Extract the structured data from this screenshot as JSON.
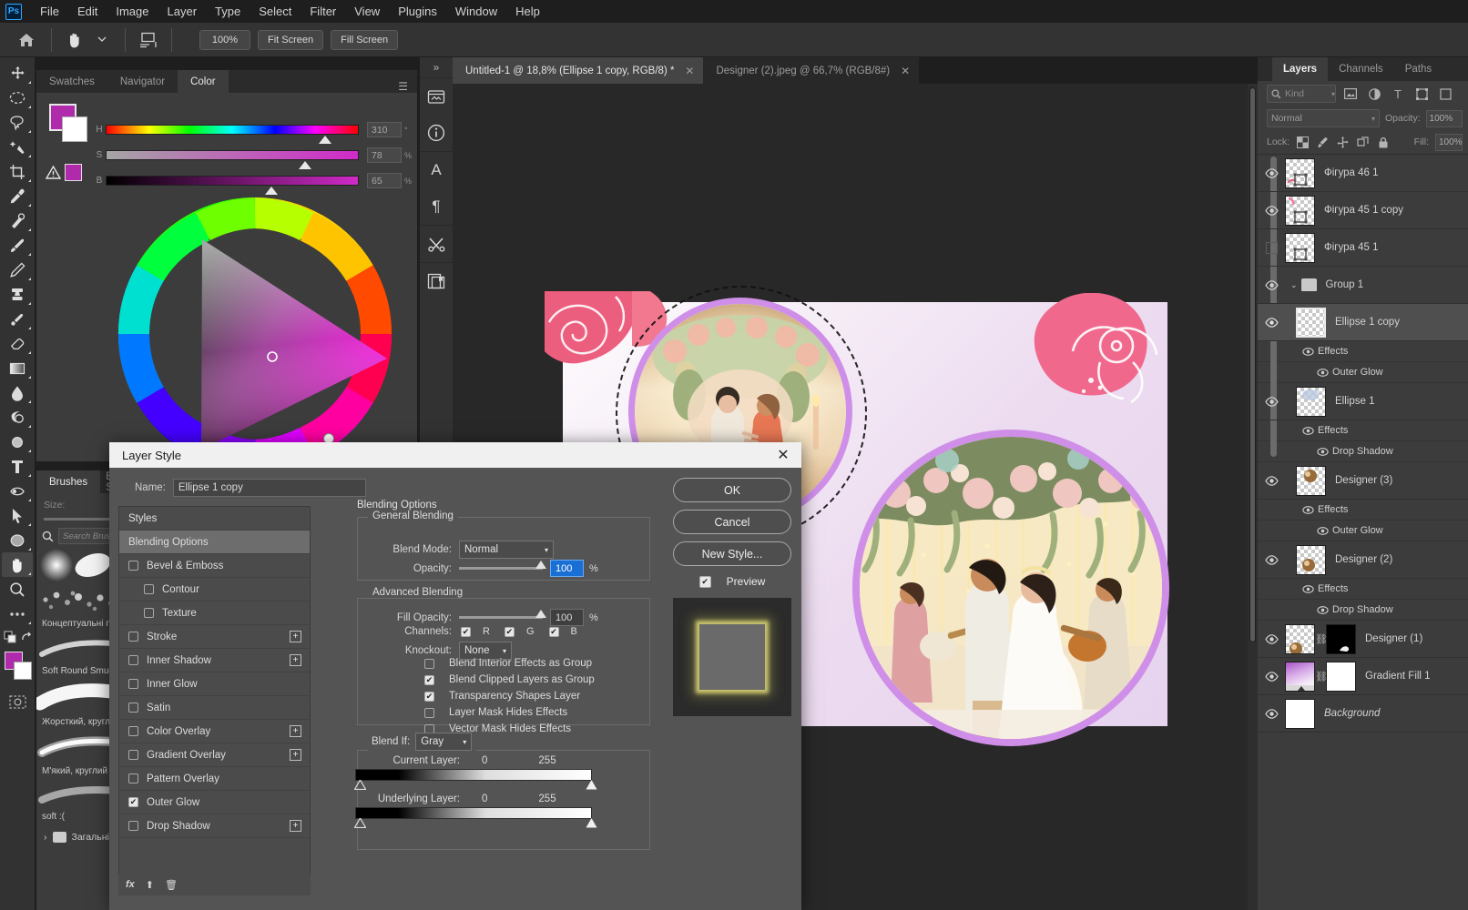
{
  "app": {
    "logo": "Ps"
  },
  "menubar": {
    "items": [
      "File",
      "Edit",
      "Image",
      "Layer",
      "Type",
      "Select",
      "Filter",
      "View",
      "Plugins",
      "Window",
      "Help"
    ]
  },
  "optionsbar": {
    "zoom_value": "100%",
    "fit_screen": "Fit Screen",
    "fill_screen": "Fill Screen",
    "home_icon": "home-icon",
    "hand_icon": "hand-tool-icon",
    "arrange_icon": "arrange-documents-icon"
  },
  "toolbar": {
    "tools": [
      {
        "name": "move-tool",
        "glyph": "✥"
      },
      {
        "name": "elliptical-marquee-tool",
        "glyph": "◯"
      },
      {
        "name": "lasso-tool",
        "glyph": "⌁"
      },
      {
        "name": "object-selection-tool",
        "glyph": "✨"
      },
      {
        "name": "crop-tool",
        "glyph": "⌗"
      },
      {
        "name": "eyedropper-tool",
        "glyph": "⟋"
      },
      {
        "name": "spot-healing-brush-tool",
        "glyph": "⦆"
      },
      {
        "name": "brush-tool",
        "glyph": "✎"
      },
      {
        "name": "clone-stamp-tool",
        "glyph": "⎈"
      },
      {
        "name": "history-brush-tool",
        "glyph": "↺"
      },
      {
        "name": "eraser-tool",
        "glyph": "▱"
      },
      {
        "name": "gradient-tool",
        "glyph": "▤"
      },
      {
        "name": "blur-tool",
        "glyph": "💧"
      },
      {
        "name": "dodge-tool",
        "glyph": "◗"
      },
      {
        "name": "pen-tool",
        "glyph": "✒"
      },
      {
        "name": "type-tool",
        "glyph": "T"
      },
      {
        "name": "path-selection-tool",
        "glyph": "➤"
      },
      {
        "name": "direct-selection-tool",
        "glyph": "➤"
      },
      {
        "name": "ellipse-tool",
        "glyph": "⬭"
      },
      {
        "name": "hand-tool",
        "glyph": "✋",
        "selected": true
      },
      {
        "name": "zoom-tool",
        "glyph": "🔍"
      },
      {
        "name": "edit-toolbar-tool",
        "glyph": "•••"
      }
    ],
    "quick_mask_icon": "quick-mask-icon",
    "screen_mode_icon": "screen-mode-icon"
  },
  "color_panel": {
    "tabs": [
      "Swatches",
      "Navigator",
      "Color"
    ],
    "active_tab": "Color",
    "menu_icon": "panel-menu-icon",
    "foreground_color": "#b02bab",
    "background_color": "#ffffff",
    "sliders": [
      {
        "label": "H",
        "value": "310",
        "unit": "°",
        "pos": 0.861
      },
      {
        "label": "S",
        "value": "78",
        "unit": "%",
        "pos": 0.783
      },
      {
        "label": "B",
        "value": "65",
        "unit": "%",
        "pos": 0.652
      }
    ],
    "warning_icon": "out-of-gamut-warning-icon"
  },
  "middle_dock": {
    "collapse_icon": "collapse-panels-icon",
    "icons": [
      {
        "name": "libraries-icon",
        "glyph": "🗂"
      },
      {
        "name": "info-icon",
        "glyph": "ⓘ"
      },
      {
        "name": "character-icon",
        "glyph": "A"
      },
      {
        "name": "paragraph-icon",
        "glyph": "¶"
      },
      {
        "name": "tool-presets-icon",
        "glyph": "✂"
      },
      {
        "name": "layer-comps-icon",
        "glyph": "❐"
      }
    ]
  },
  "document_tabs": [
    {
      "label": "Untitled-1 @ 18,8% (Ellipse 1 copy, RGB/8) *",
      "active": true,
      "close": "✕"
    },
    {
      "label": "Designer (2).jpeg @ 66,7% (RGB/8#)",
      "active": false,
      "close": "✕"
    }
  ],
  "layers_panel": {
    "tabs": [
      "Layers",
      "Channels",
      "Paths"
    ],
    "active_tab": "Layers",
    "filter_kind_label": "Kind",
    "filter_icons": [
      "pixel-filter-icon",
      "adjustment-filter-icon",
      "type-filter-icon",
      "shape-filter-icon",
      "smart-object-filter-icon"
    ],
    "blend_mode": "Normal",
    "opacity_label": "Opacity:",
    "opacity_value": "100%",
    "lock_label": "Lock:",
    "lock_icons": [
      "lock-transparent-pixels-icon",
      "lock-image-pixels-icon",
      "lock-position-icon",
      "lock-artboard-icon",
      "lock-all-icon"
    ],
    "fill_label": "Fill:",
    "fill_value": "100%",
    "layers": [
      {
        "name": "Фігура 46 1",
        "visible": true,
        "type": "shape",
        "selected": false
      },
      {
        "name": "Фігура 45 1 copy",
        "visible": true,
        "type": "shape",
        "selected": false
      },
      {
        "name": "Фігура 45 1",
        "visible": false,
        "type": "shape",
        "selected": false
      },
      {
        "name": "Group 1",
        "visible": true,
        "type": "group",
        "selected": false
      },
      {
        "name": "Ellipse 1 copy",
        "visible": true,
        "type": "shape",
        "selected": true,
        "effects": {
          "label": "Effects",
          "items": [
            "Outer Glow"
          ]
        }
      },
      {
        "name": "Ellipse 1",
        "visible": true,
        "type": "shape",
        "selected": false,
        "effects": {
          "label": "Effects",
          "items": [
            "Drop Shadow"
          ]
        }
      },
      {
        "name": "Designer (3)",
        "visible": true,
        "type": "image",
        "selected": false,
        "effects": {
          "label": "Effects",
          "items": [
            "Outer Glow"
          ]
        }
      },
      {
        "name": "Designer (2)",
        "visible": true,
        "type": "image",
        "selected": false,
        "effects": {
          "label": "Effects",
          "items": [
            "Drop Shadow"
          ]
        }
      },
      {
        "name": "Designer (1)",
        "visible": true,
        "type": "masked",
        "selected": false
      },
      {
        "name": "Gradient Fill 1",
        "visible": true,
        "type": "gradient",
        "selected": false
      },
      {
        "name": "Background",
        "visible": true,
        "type": "background",
        "selected": false,
        "italic": true
      }
    ]
  },
  "brushes_panel": {
    "tabs": [
      "Brushes",
      "Brush Settings"
    ],
    "active_tab": "Brushes",
    "size_label": "Size:",
    "search_placeholder": "Search Brushes",
    "search_icon": "search-icon",
    "items": [
      {
        "label": "Концептуальні пензлі"
      },
      {
        "label": "Soft Round Smudge"
      },
      {
        "label": "Жорсткий, круглий"
      },
      {
        "label": "М'який, круглий"
      },
      {
        "label": "soft :("
      }
    ],
    "folder": "Загальні"
  },
  "dialog": {
    "title": "Layer Style",
    "close_icon": "close-icon",
    "name_label": "Name:",
    "name_value": "Ellipse 1 copy",
    "styles_header": "Styles",
    "style_rows": [
      {
        "label": "Styles",
        "kind": "header"
      },
      {
        "label": "Blending Options",
        "kind": "active"
      },
      {
        "label": "Bevel & Emboss",
        "checked": false
      },
      {
        "label": "Contour",
        "checked": false,
        "indent": true
      },
      {
        "label": "Texture",
        "checked": false,
        "indent": true
      },
      {
        "label": "Stroke",
        "checked": false,
        "plus": true
      },
      {
        "label": "Inner Shadow",
        "checked": false,
        "plus": true
      },
      {
        "label": "Inner Glow",
        "checked": false
      },
      {
        "label": "Satin",
        "checked": false
      },
      {
        "label": "Color Overlay",
        "checked": false,
        "plus": true
      },
      {
        "label": "Gradient Overlay",
        "checked": false,
        "plus": true
      },
      {
        "label": "Pattern Overlay",
        "checked": false
      },
      {
        "label": "Outer Glow",
        "checked": true
      },
      {
        "label": "Drop Shadow",
        "checked": false,
        "plus": true
      }
    ],
    "fx_icons": [
      "fx-icon",
      "new-effect-icon",
      "delete-effect-icon"
    ],
    "blending_options_title": "Blending Options",
    "general_blending": {
      "legend": "General Blending",
      "blend_mode_label": "Blend Mode:",
      "blend_mode_value": "Normal",
      "opacity_label": "Opacity:",
      "opacity_value": "100",
      "opacity_unit": "%"
    },
    "advanced_blending": {
      "legend": "Advanced Blending",
      "fill_opacity_label": "Fill Opacity:",
      "fill_opacity_value": "100",
      "fill_opacity_unit": "%",
      "channels_label": "Channels:",
      "channels": [
        {
          "label": "R",
          "checked": true
        },
        {
          "label": "G",
          "checked": true
        },
        {
          "label": "B",
          "checked": true
        }
      ],
      "knockout_label": "Knockout:",
      "knockout_value": "None",
      "checkboxes": [
        {
          "label": "Blend Interior Effects as Group",
          "checked": false
        },
        {
          "label": "Blend Clipped Layers as Group",
          "checked": true
        },
        {
          "label": "Transparency Shapes Layer",
          "checked": true
        },
        {
          "label": "Layer Mask Hides Effects",
          "checked": false
        },
        {
          "label": "Vector Mask Hides Effects",
          "checked": false
        }
      ]
    },
    "blend_if": {
      "label": "Blend If:",
      "channel": "Gray",
      "current_layer_label": "Current Layer:",
      "current_layer_min": "0",
      "current_layer_max": "255",
      "underlying_layer_label": "Underlying Layer:",
      "underlying_layer_min": "0",
      "underlying_layer_max": "255"
    },
    "buttons": {
      "ok": "OK",
      "cancel": "Cancel",
      "new_style": "New Style..."
    },
    "preview": {
      "label": "Preview",
      "checked": true
    }
  },
  "colors": {
    "menubar_bg": "#1e1e1e",
    "panel_bg": "#3c3c3c",
    "canvas_bg": "#282828",
    "dialog_bg": "#545454",
    "accent_magenta": "#b02bab",
    "ring_purple": "#cf8fe8",
    "selection_blue": "#1a6fd4"
  }
}
